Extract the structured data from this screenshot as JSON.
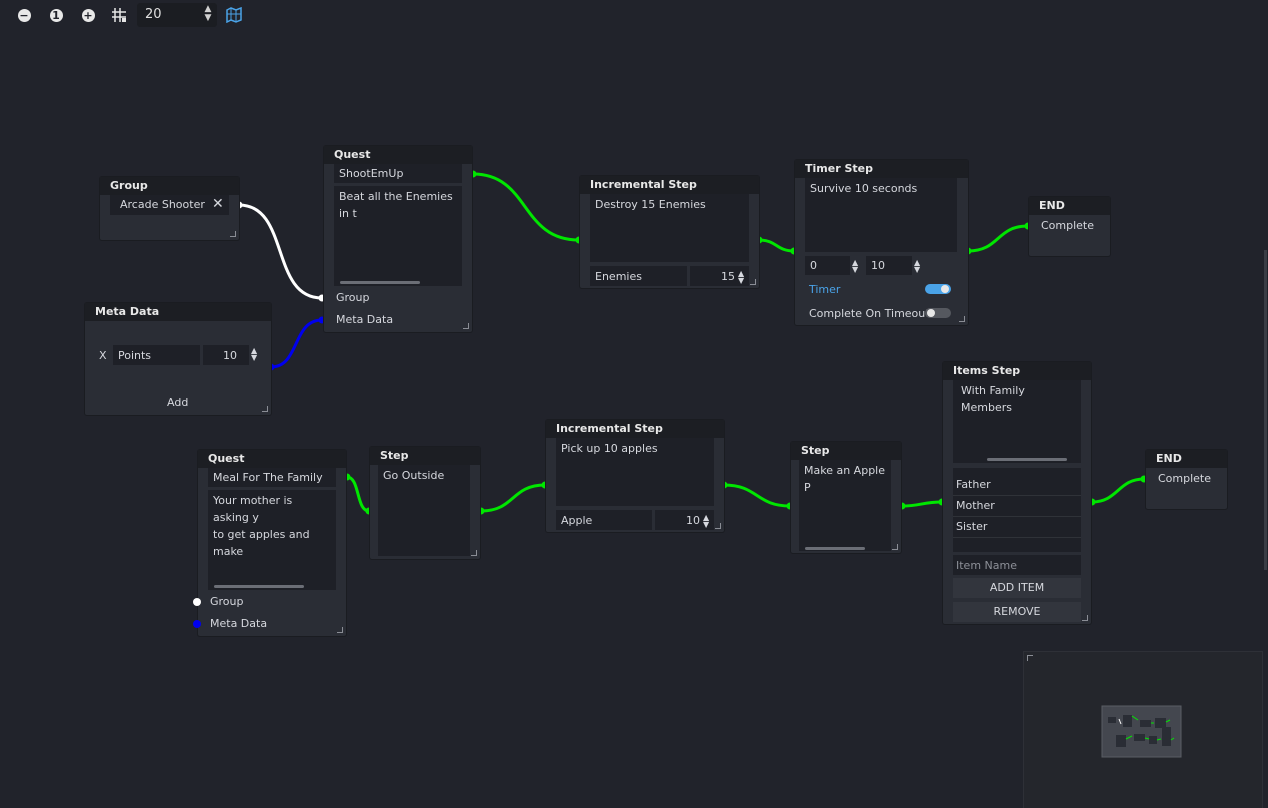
{
  "toolbar": {
    "zoom_out_icon": "minus-circle",
    "zoom_reset_label": "1",
    "zoom_in_icon": "plus-circle",
    "snap_icon": "grid-snap",
    "snap_value": "20",
    "minimap_icon": "map"
  },
  "colors": {
    "accent_wire": "#00e600",
    "group_wire": "#ffffff",
    "meta_wire": "#0000ee",
    "toggle_on": "#4aa3e8"
  },
  "group_node": {
    "title": "Group",
    "value": "Arcade Shooter",
    "clear_icon": "close-icon"
  },
  "meta_node": {
    "title": "Meta Data",
    "remove_label": "X",
    "key": "Points",
    "value": "10",
    "add_label": "Add"
  },
  "quest1": {
    "title": "Quest",
    "name": "ShootEmUp",
    "description": "Beat all the Enemies in t",
    "group_label": "Group",
    "meta_label": "Meta Data"
  },
  "inc1": {
    "title": "Incremental Step",
    "description": "Destroy 15 Enemies",
    "item": "Enemies",
    "count": "15"
  },
  "timer": {
    "title": "Timer Step",
    "description": "Survive 10 seconds",
    "min": "0",
    "max": "10",
    "timer_label": "Timer",
    "timeout_label": "Complete On Timeout",
    "timer_on": true,
    "timeout_on": false
  },
  "end1": {
    "title": "END",
    "label": "Complete"
  },
  "quest2": {
    "title": "Quest",
    "name": "Meal For The Family",
    "description_line1": "Your mother is asking y",
    "description_line2": "to get apples and make",
    "group_label": "Group",
    "meta_label": "Meta Data"
  },
  "step1": {
    "title": "Step",
    "description": "Go Outside"
  },
  "inc2": {
    "title": "Incremental Step",
    "description": "Pick up 10 apples",
    "item": "Apple",
    "count": "10"
  },
  "step2": {
    "title": "Step",
    "description": "Make an Apple P"
  },
  "items": {
    "title": "Items Step",
    "description": "With Family Members",
    "list": [
      "Father",
      "Mother",
      "Sister"
    ],
    "placeholder": "Item Name",
    "add_label": "ADD ITEM",
    "remove_label": "REMOVE"
  },
  "end2": {
    "title": "END",
    "label": "Complete"
  }
}
